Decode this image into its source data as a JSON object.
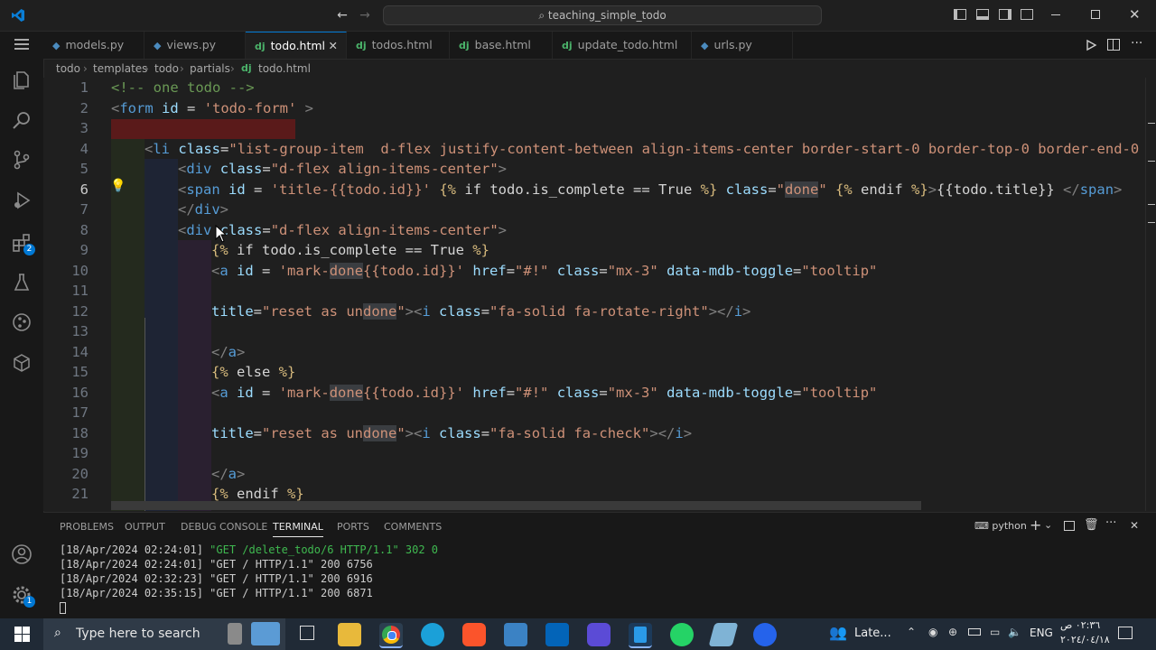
{
  "titlebar": {
    "search_text": "teaching_simple_todo",
    "nav_back": "←",
    "nav_forward": "→"
  },
  "tabs": [
    {
      "label": "models.py",
      "icon": "python-icon"
    },
    {
      "label": "views.py",
      "icon": "python-icon"
    },
    {
      "label": "todo.html",
      "icon": "django-icon",
      "active": true
    },
    {
      "label": "todos.html",
      "icon": "django-icon"
    },
    {
      "label": "base.html",
      "icon": "django-icon"
    },
    {
      "label": "update_todo.html",
      "icon": "django-icon"
    },
    {
      "label": "urls.py",
      "icon": "python-icon"
    }
  ],
  "breadcrumb": {
    "parts": [
      "todo",
      "templates",
      "todo",
      "partials",
      "todo.html"
    ],
    "sep": "›"
  },
  "editor": {
    "line_numbers": [
      "1",
      "2",
      "3",
      "4",
      "5",
      "6",
      "7",
      "8",
      "9",
      "10",
      "11",
      "12",
      "13",
      "14",
      "15",
      "16",
      "17",
      "18",
      "19",
      "20",
      "21"
    ],
    "current_line": "6"
  },
  "panel": {
    "tabs": [
      "PROBLEMS",
      "OUTPUT",
      "DEBUG CONSOLE",
      "TERMINAL",
      "PORTS",
      "COMMENTS"
    ],
    "active_tab": "TERMINAL",
    "shell_label": "python",
    "terminal_lines": [
      "[18/Apr/2024 02:24:01] \"GET /delete_todo/6 HTTP/1.1\" 302 0",
      "[18/Apr/2024 02:24:01] \"GET / HTTP/1.1\" 200 6756",
      "[18/Apr/2024 02:32:23] \"GET / HTTP/1.1\" 200 6916",
      "[18/Apr/2024 02:35:15] \"GET / HTTP/1.1\" 200 6871"
    ],
    "first_line_color": "#3fb950"
  },
  "taskbar": {
    "search_placeholder": "Type here to search",
    "news_label": "Late...",
    "lang": "ENG",
    "time": "٠٢:٣٦ ص",
    "date": "٢٠٢٤/٠٤/١٨"
  },
  "activity_badges": {
    "extensions": "2",
    "settings": "1"
  },
  "colors": {
    "accent": "#0078d4",
    "background": "#1f1f1f"
  }
}
